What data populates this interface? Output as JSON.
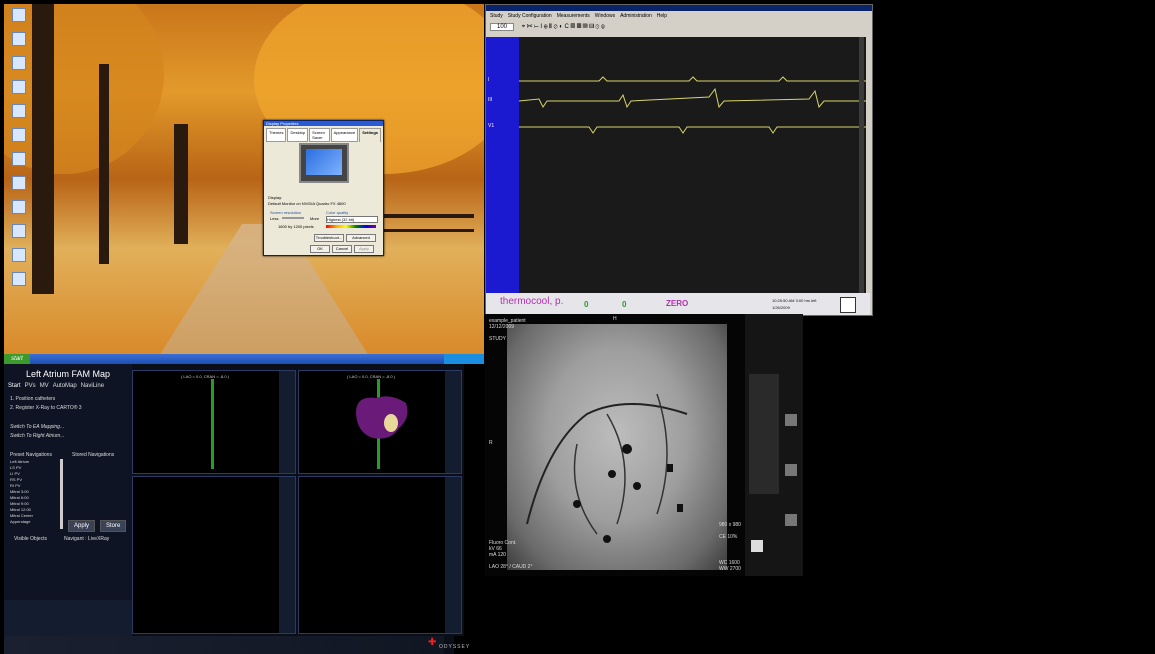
{
  "desktop": {
    "icons": [
      "",
      "",
      "",
      "",
      "",
      "",
      "",
      "",
      "",
      "",
      "",
      "",
      ""
    ],
    "dialog": {
      "title": "Display Properties",
      "tabs": [
        "Themes",
        "Desktop",
        "Screen Saver",
        "Appearance",
        "Settings"
      ],
      "display_label": "Display:",
      "display_value": "Default Monitor on NVIDIA Quadro FX 4600",
      "resolution_label": "Screen resolution",
      "less": "Less",
      "more": "More",
      "resolution_value": "1600 by 1200 pixels",
      "color_label": "Color quality",
      "color_value": "Highest (32 bit)",
      "troubleshoot": "Troubleshoot...",
      "advanced": "Advanced",
      "ok": "OK",
      "cancel": "Cancel",
      "apply": "Apply"
    },
    "start_label": "start"
  },
  "recording": {
    "menu": [
      "Study",
      "Study Configuration",
      "Measurements",
      "Windows",
      "Administration",
      "Help"
    ],
    "zoom": "100",
    "tools": "⌖ ✂ ⊢ I ⊕ 𝄃𝄃 ⊘ ◐ C ▤ ▦ ▥ ▨ ⊙ ⊛",
    "leads": [
      "I",
      "III",
      "V1"
    ],
    "patient": "thermocool, p.",
    "v1": "0",
    "v2": "0",
    "zero": "ZERO",
    "info1": "10:25:50 AM  3:00 hrs left",
    "info2": "1/26/2009"
  },
  "carto": {
    "title": "Left Atrium FAM Map",
    "tabs": [
      "Start",
      "PVs",
      "MV",
      "AutoMap",
      "NaviLine"
    ],
    "steps": [
      "1.   Position catheters",
      "2.   Register X-Ray to CARTO® 3"
    ],
    "links": [
      "Switch To EA Mapping...",
      "Switch To Right Atrium..."
    ],
    "preset_label": "Preset Navigations",
    "stored_label": "Stored Navigations",
    "presets": [
      "Left Atrium",
      "LS PV",
      "LI PV",
      "RS PV",
      "RI PV",
      "Mitral 3:00",
      "Mitral 6:00",
      "Mitral 9:00",
      "Mitral 12:00",
      "Mitral Center",
      "Appendage"
    ],
    "apply": "Apply",
    "store": "Store",
    "visible_objects": "Visible Objects",
    "navigant": "Navigant : LiveXRay",
    "viewport_title1": "( LAO = 0.0, CRAN = -8.0 )",
    "viewport_title2": "( LAO = 0.0, CRAN = -8.0 )",
    "brand": "ODYSSEY"
  },
  "fluoro": {
    "patient": "example_patient",
    "date": "12/12/2009",
    "study": "STUDY",
    "plane": "H",
    "left_mid": "R",
    "orientation": "LAO 28° / CAUD 2°",
    "stats": "Fluoro Cont.",
    "kv": "kV 66",
    "ma": "mA 120",
    "size": "980 x 980",
    "ce": "CE 10%",
    "wc": "WC 1600",
    "ww": "WW 2700"
  },
  "colors": {
    "waveform": "#d8d46a",
    "blue_bar": "#1c1ad0",
    "patient_name": "#b02fb0",
    "carto_green": "#2a9a2a",
    "atrium": "#6a1b7a"
  }
}
